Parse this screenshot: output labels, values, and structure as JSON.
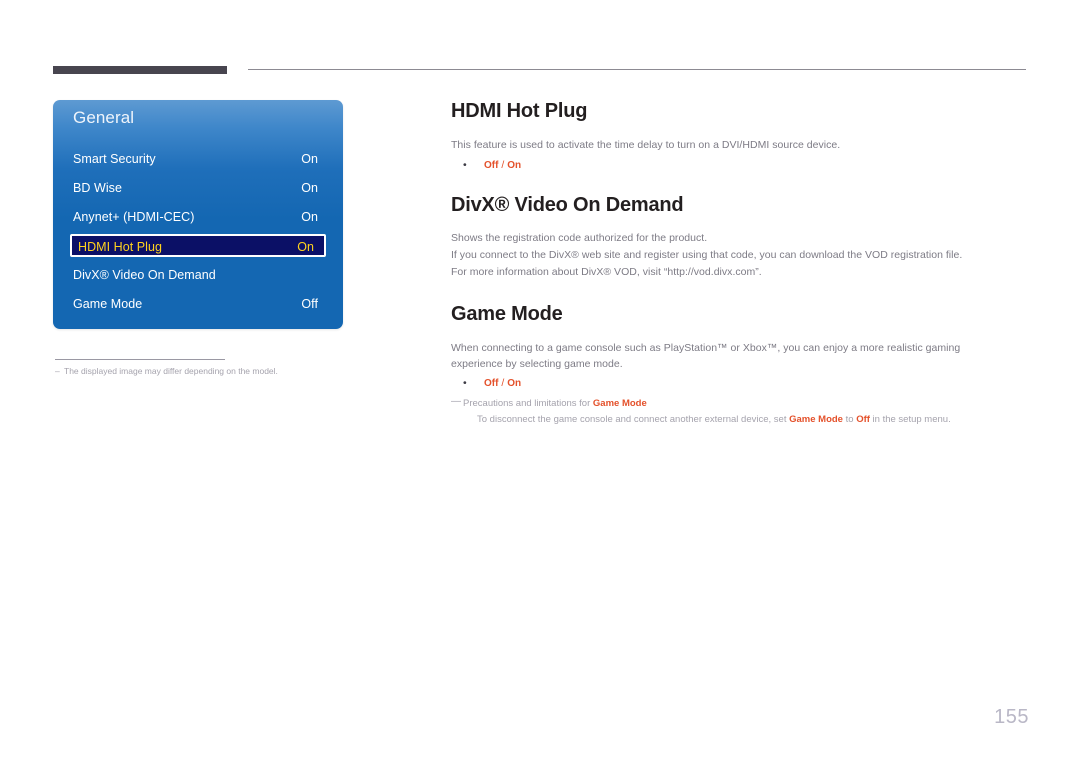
{
  "page": {
    "number": "155"
  },
  "osd": {
    "title": "General",
    "rows": [
      {
        "label": "Smart Security",
        "value": "On",
        "selected": false
      },
      {
        "label": "BD Wise",
        "value": "On",
        "selected": false
      },
      {
        "label": "Anynet+ (HDMI-CEC)",
        "value": "On",
        "selected": false
      },
      {
        "label": "HDMI Hot Plug",
        "value": "On",
        "selected": true
      },
      {
        "label": "DivX® Video On Demand",
        "value": "",
        "selected": false
      },
      {
        "label": "Game Mode",
        "value": "Off",
        "selected": false
      }
    ],
    "colors": {
      "panel_top": "#5e9ad2",
      "panel_bottom": "#1467b2",
      "selected_bg": "#0b1066",
      "selected_text": "#ffd21e",
      "selected_border": "#ffffff"
    }
  },
  "left_note": {
    "dash": "–",
    "text": "The displayed image may differ depending on the model."
  },
  "sections": {
    "hdmi_hot_plug": {
      "heading": "HDMI Hot Plug",
      "body": "This feature is used to activate the time delay to turn on a DVI/HDMI source device.",
      "option_off": "Off",
      "option_sep": " / ",
      "option_on": "On",
      "bullet": "•"
    },
    "divx": {
      "heading": "DivX® Video On Demand",
      "line1": "Shows the registration code authorized for the product.",
      "line2": "If you connect to the DivX® web site and register using that code, you can download the VOD registration file.",
      "line3": "For more information about DivX® VOD, visit “http://vod.divx.com”."
    },
    "game_mode": {
      "heading": "Game Mode",
      "body": "When connecting to a game console such as PlayStation™ or Xbox™, you can enjoy a more realistic gaming experience by selecting game mode.",
      "option_off": "Off",
      "option_sep": " / ",
      "option_on": "On",
      "bullet": "•",
      "note": {
        "dash": "—",
        "title_prefix": "Precautions and limitations for ",
        "title_em": "Game Mode",
        "detail_p1": "To disconnect the game console and connect another external device, set ",
        "detail_em1": "Game Mode",
        "detail_p2": " to ",
        "detail_em2": "Off",
        "detail_p3": " in the setup menu."
      }
    }
  },
  "colors": {
    "heading": "#231f20",
    "body_text": "#7d7b85",
    "accent_orange": "#e4512b",
    "note_gray": "#a5a3ad",
    "header_bar": "#48454f",
    "page_number": "#b9b7c6"
  }
}
